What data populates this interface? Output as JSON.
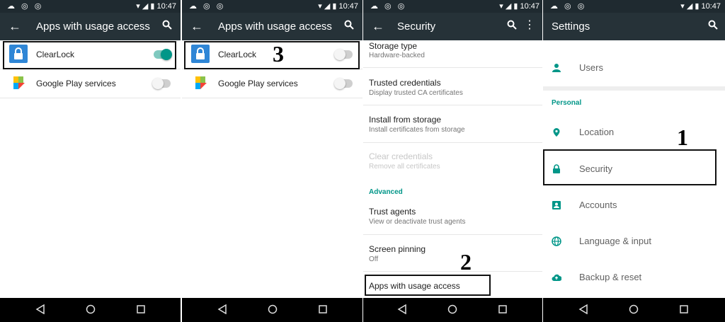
{
  "status": {
    "time": "10:47"
  },
  "screen1": {
    "title": "Apps with usage access",
    "apps": [
      {
        "label": "ClearLock",
        "toggle": "on"
      },
      {
        "label": "Google Play services",
        "toggle": "off"
      }
    ]
  },
  "screen2": {
    "title": "Apps with usage access",
    "apps": [
      {
        "label": "ClearLock",
        "toggle": "off"
      },
      {
        "label": "Google Play services",
        "toggle": "off"
      }
    ],
    "step_number": "3"
  },
  "screen3": {
    "title": "Security",
    "items": [
      {
        "title": "Storage type",
        "subtitle": "Hardware-backed"
      },
      {
        "title": "Trusted credentials",
        "subtitle": "Display trusted CA certificates"
      },
      {
        "title": "Install from storage",
        "subtitle": "Install certificates from storage"
      },
      {
        "title": "Clear credentials",
        "subtitle": "Remove all certificates",
        "disabled": true
      }
    ],
    "advanced_header": "Advanced",
    "advanced_items": [
      {
        "title": "Trust agents",
        "subtitle": "View or deactivate trust agents"
      },
      {
        "title": "Screen pinning",
        "subtitle": "Off"
      },
      {
        "title": "Apps with usage access"
      }
    ],
    "step_number": "2"
  },
  "screen4": {
    "title": "Settings",
    "users_label": "Users",
    "personal_header": "Personal",
    "items": [
      {
        "label": "Location",
        "icon": "location-icon"
      },
      {
        "label": "Security",
        "icon": "lock-icon"
      },
      {
        "label": "Accounts",
        "icon": "account-box-icon"
      },
      {
        "label": "Language & input",
        "icon": "globe-icon"
      },
      {
        "label": "Backup & reset",
        "icon": "cloud-upload-icon"
      }
    ],
    "step_number": "1"
  },
  "colors": {
    "toolbar": "#263238",
    "statusbar": "#1f2a30",
    "accent": "#009688",
    "navbar": "#000000"
  }
}
